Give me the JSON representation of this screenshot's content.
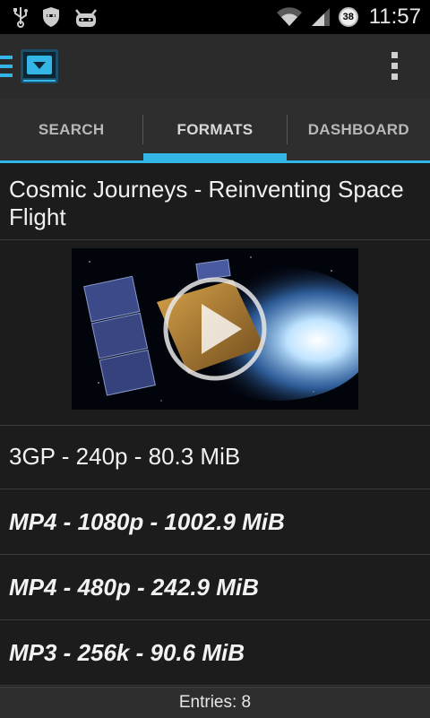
{
  "status_bar": {
    "time": "11:57",
    "battery_level": "38",
    "icons": [
      "usb-icon",
      "shield-icon",
      "cyanogenmod-icon",
      "wifi-icon",
      "signal-icon",
      "battery-icon"
    ]
  },
  "action_bar": {
    "accent_color": "#33b5e5"
  },
  "tabs": [
    {
      "label": "SEARCH"
    },
    {
      "label": "FORMATS",
      "active": true
    },
    {
      "label": "DASHBOARD"
    }
  ],
  "video": {
    "title": "Cosmic Journeys - Reinventing Space Flight"
  },
  "formats": [
    {
      "label": "3GP - 240p - 80.3 MiB",
      "bold": false
    },
    {
      "label": "MP4 - 1080p - 1002.9 MiB",
      "bold": true
    },
    {
      "label": "MP4 - 480p - 242.9 MiB",
      "bold": true
    },
    {
      "label": "MP3 - 256k - 90.6 MiB",
      "bold": true
    }
  ],
  "footer": {
    "entries_text": "Entries: 8"
  }
}
